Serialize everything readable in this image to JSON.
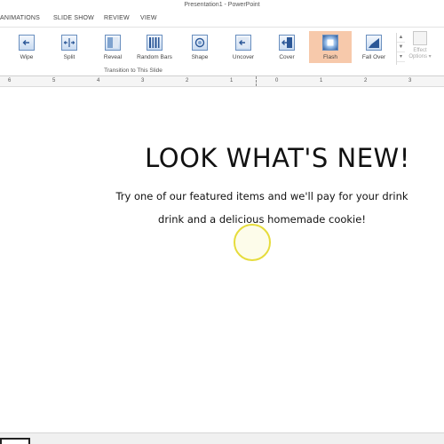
{
  "window": {
    "title": "Presentation1 - PowerPoint"
  },
  "tabs": [
    {
      "label": "ANIMATIONS"
    },
    {
      "label": "SLIDE SHOW"
    },
    {
      "label": "REVIEW"
    },
    {
      "label": "VIEW"
    }
  ],
  "ribbon": {
    "transitions": [
      {
        "label": "Wipe",
        "icon": "wipe-transition-icon",
        "selected": false
      },
      {
        "label": "Split",
        "icon": "split-transition-icon",
        "selected": false
      },
      {
        "label": "Reveal",
        "icon": "reveal-transition-icon",
        "selected": false
      },
      {
        "label": "Random Bars",
        "icon": "random-bars-transition-icon",
        "selected": false
      },
      {
        "label": "Shape",
        "icon": "shape-transition-icon",
        "selected": false
      },
      {
        "label": "Uncover",
        "icon": "uncover-transition-icon",
        "selected": false
      },
      {
        "label": "Cover",
        "icon": "cover-transition-icon",
        "selected": false
      },
      {
        "label": "Flash",
        "icon": "flash-transition-icon",
        "selected": true
      },
      {
        "label": "Fall Over",
        "icon": "fall-over-transition-icon",
        "selected": false
      }
    ],
    "effect_options": {
      "line1": "Effect",
      "line2": "Options ▾",
      "enabled": false
    },
    "group_label": "Transition to This Slide",
    "selected_color": "#f7c9ab"
  },
  "ruler": {
    "labels": [
      "6",
      "5",
      "4",
      "3",
      "2",
      "1",
      "0",
      "1",
      "2",
      "3"
    ]
  },
  "slide": {
    "headline": "LOOK WHAT'S NEW!",
    "line1": "Try one of our featured items and we'll pay for your drink",
    "line2": "drink and a delicious homemade cookie!"
  },
  "cursor": {
    "ring_color": "#e6dc3c"
  }
}
